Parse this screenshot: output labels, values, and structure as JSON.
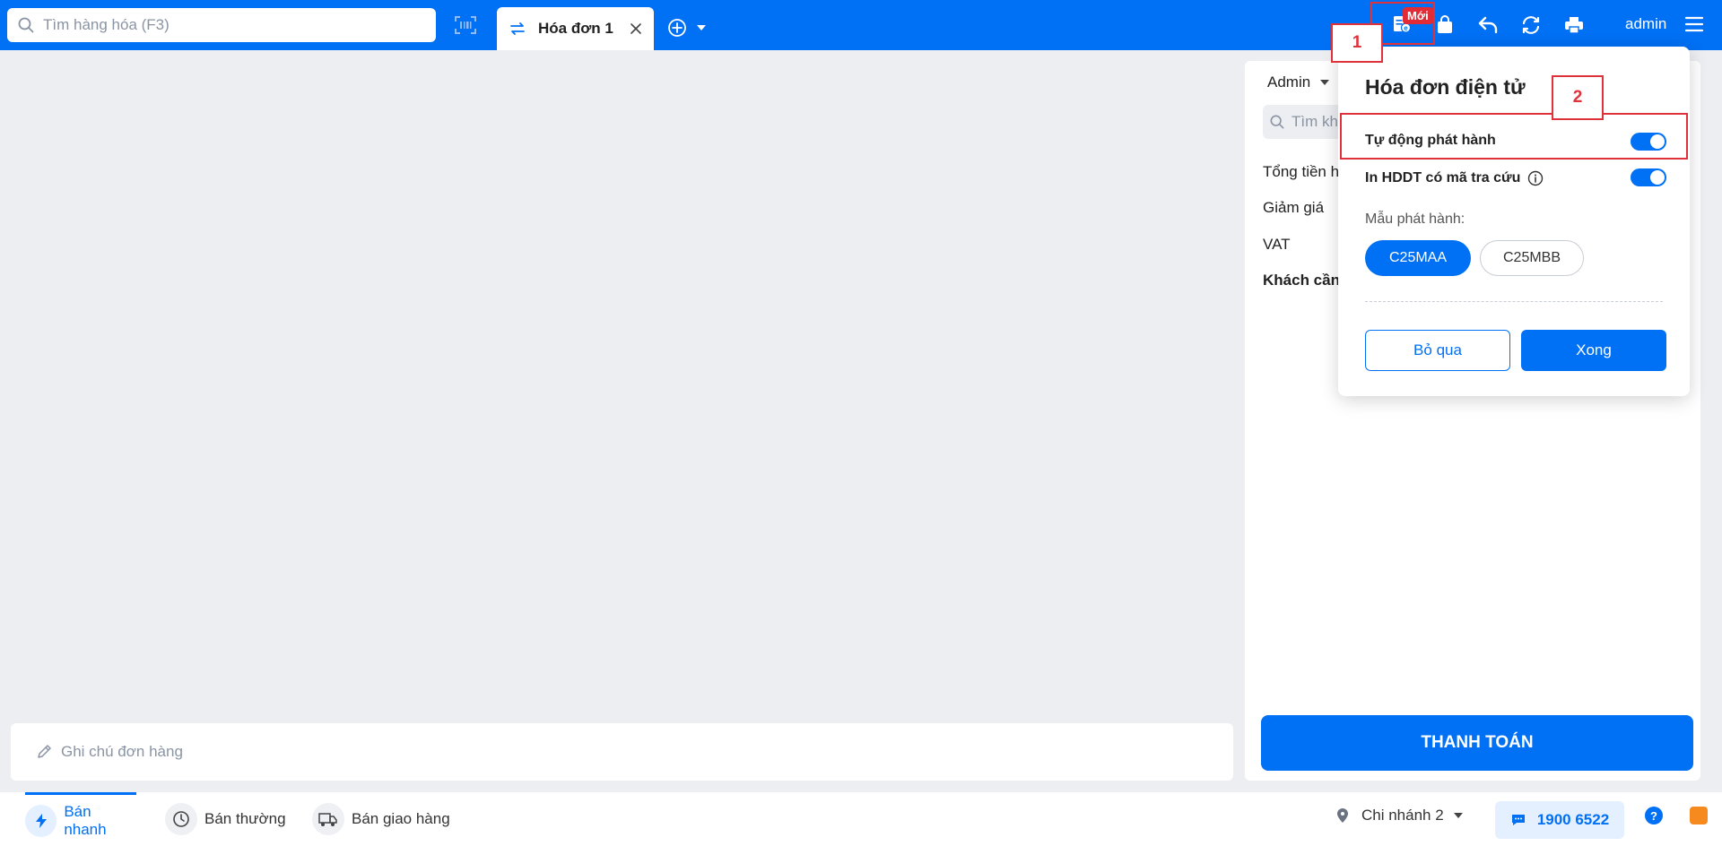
{
  "header": {
    "search_placeholder": "Tìm hàng hóa (F3)",
    "tab_label": "Hóa đơn 1",
    "new_badge": "Mới",
    "user_name": "admin"
  },
  "annotations": {
    "first": "1",
    "second": "2"
  },
  "left_panel": {
    "note_placeholder": "Ghi chú đơn hàng"
  },
  "right_panel": {
    "seller": "Admin",
    "customer_search_placeholder": "Tìm khá",
    "rows": {
      "total": "Tổng tiền h",
      "discount": "Giảm giá",
      "vat": "VAT",
      "customer_pay": "Khách cần t"
    },
    "pay_button": "THANH TOÁN"
  },
  "einvoice_popup": {
    "title": "Hóa đơn điện tử",
    "auto_issue_label": "Tự động phát hành",
    "auto_issue_on": true,
    "print_lookup_label": "In HDDT có mã tra cứu",
    "print_lookup_on": true,
    "template_label": "Mẫu phát hành:",
    "templates": [
      "C25MAA",
      "C25MBB"
    ],
    "selected_template": "C25MAA",
    "skip_button": "Bỏ qua",
    "done_button": "Xong"
  },
  "bottom_bar": {
    "tabs": [
      "Bán nhanh",
      "Bán thường",
      "Bán giao hàng"
    ],
    "active_tab": "Bán nhanh",
    "branch": "Chi nhánh 2",
    "hotline": "1900 6522"
  },
  "colors": {
    "primary": "#0070f4",
    "annotation": "#e0323a",
    "badge": "#e12b36"
  }
}
